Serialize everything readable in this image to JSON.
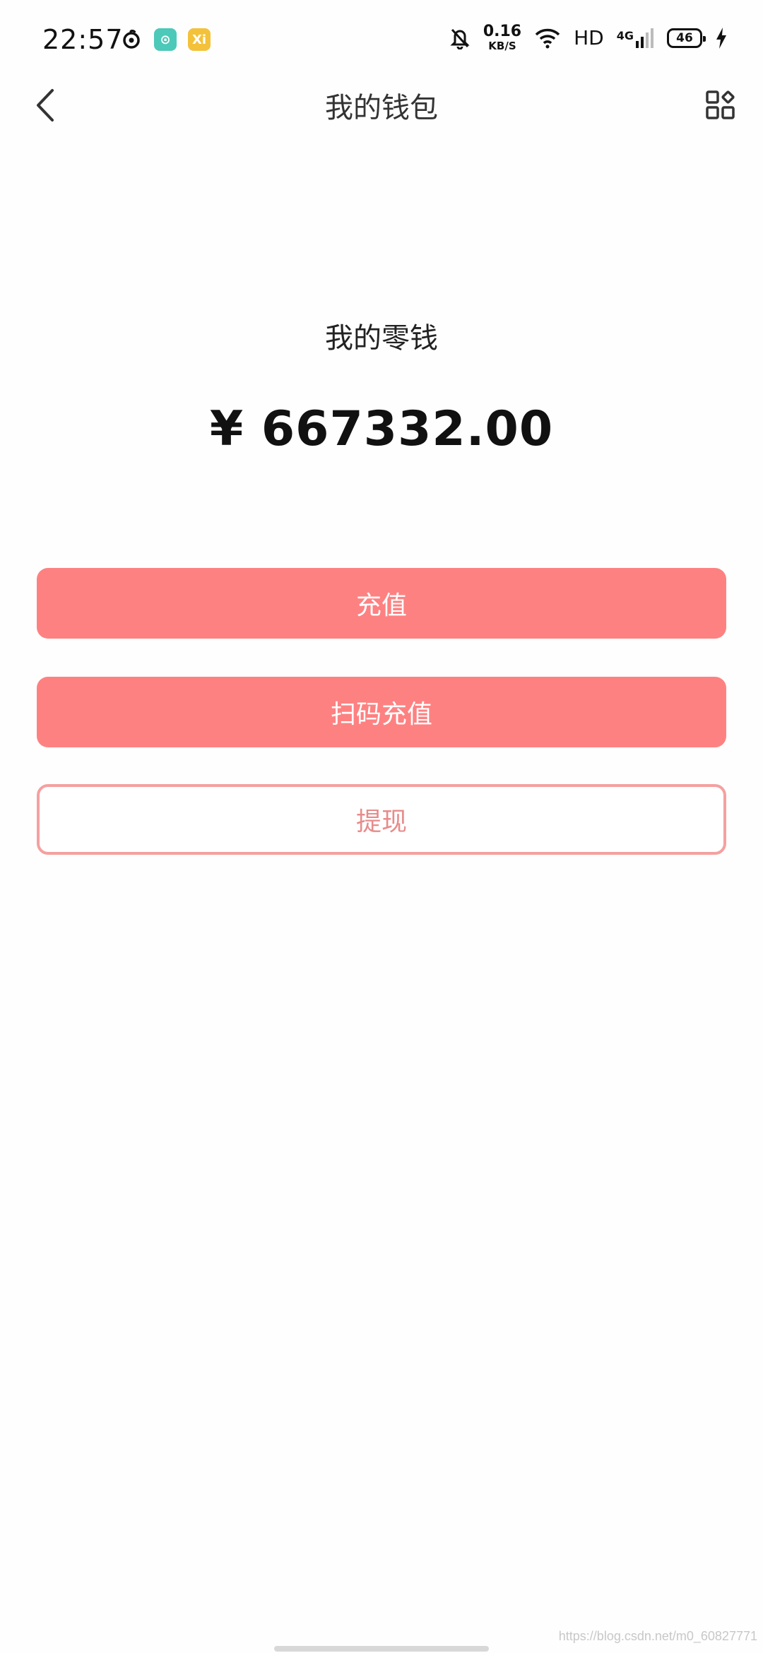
{
  "status_bar": {
    "time": "22:57",
    "net_speed_value": "0.16",
    "net_speed_unit": "KB/S",
    "hd_label": "HD",
    "network_label": "4G",
    "battery_level": "46",
    "app_icon_2_glyph": "⊙",
    "app_icon_3_glyph": "Xi",
    "app_icon_2_color": "#4cc9b8",
    "app_icon_3_color": "#f3c23a"
  },
  "header": {
    "title": "我的钱包"
  },
  "balance": {
    "label": "我的零钱",
    "amount": "¥ 667332.00"
  },
  "buttons": {
    "recharge_label": "充值",
    "scan_recharge_label": "扫码充值",
    "withdraw_label": "提现"
  },
  "watermark": "https://blog.csdn.net/m0_60827771",
  "colors": {
    "accent": "#fe8181",
    "outline": "#f5a0a0"
  }
}
